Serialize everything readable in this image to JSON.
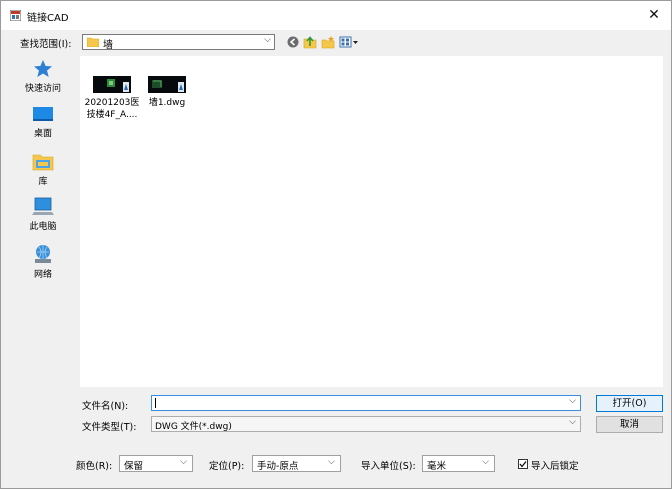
{
  "window": {
    "title": "链接CAD",
    "close": "✕"
  },
  "lookin": {
    "label": "查找范围(I):",
    "value": "墙"
  },
  "toolbar": {
    "back_icon": "back-icon",
    "up_icon": "up-folder-icon",
    "newfolder_icon": "new-folder-icon",
    "view_icon": "view-menu-icon"
  },
  "sidebar": {
    "items": [
      {
        "label": "快速访问",
        "icon": "star-icon"
      },
      {
        "label": "桌面",
        "icon": "desktop-icon"
      },
      {
        "label": "库",
        "icon": "library-icon"
      },
      {
        "label": "此电脑",
        "icon": "computer-icon"
      },
      {
        "label": "网络",
        "icon": "network-icon"
      }
    ]
  },
  "files": [
    {
      "name_line1": "20201203医",
      "name_line2": "技楼4F_A...."
    },
    {
      "name_line1": "墙1.dwg",
      "name_line2": ""
    }
  ],
  "form": {
    "filename_label": "文件名(N):",
    "filename_value": "",
    "filetype_label": "文件类型(T):",
    "filetype_value": "DWG 文件(*.dwg)",
    "open_button": "打开(O)",
    "cancel_button": "取消"
  },
  "options": {
    "color_label": "颜色(R):",
    "color_value": "保留",
    "position_label": "定位(P):",
    "position_value": "手动-原点",
    "unit_label": "导入单位(S):",
    "unit_value": "毫米",
    "lock_label": "导入后锁定",
    "lock_checked": true
  }
}
